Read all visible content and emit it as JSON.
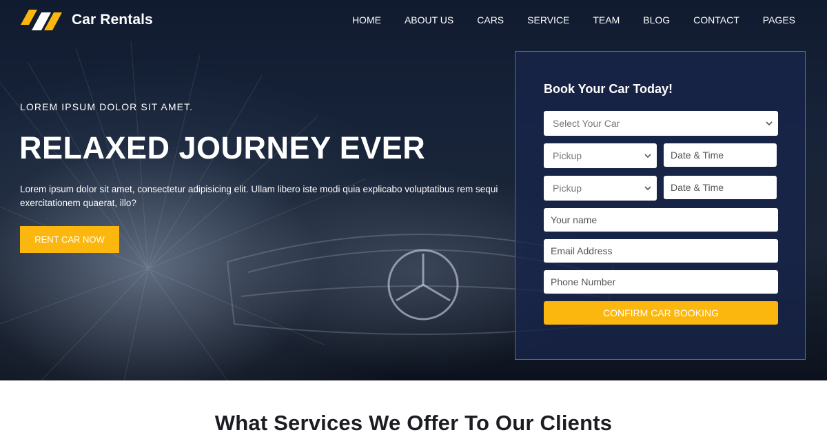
{
  "brand": {
    "name": "Car Rentals",
    "logo_icon": "brand-logo-icon",
    "accent": "#fcb70e"
  },
  "nav": [
    {
      "label": "HOME"
    },
    {
      "label": "ABOUT US"
    },
    {
      "label": "CARS"
    },
    {
      "label": "SERVICE"
    },
    {
      "label": "TEAM"
    },
    {
      "label": "BLOG"
    },
    {
      "label": "CONTACT"
    },
    {
      "label": "PAGES"
    }
  ],
  "hero": {
    "eyebrow": "LOREM IPSUM DOLOR SIT AMET.",
    "title": "RELAXED JOURNEY EVER",
    "lede": "Lorem ipsum dolor sit amet, consectetur adipisicing elit. Ullam libero iste modi quia explicabo voluptatibus rem sequi exercitationem quaerat, illo?",
    "cta": "RENT CAR NOW"
  },
  "booking": {
    "title": "Book Your Car Today!",
    "car_select": "Select Your Car",
    "pickup_1": "Pickup",
    "datetime_1": "Date & Time",
    "pickup_2": "Pickup",
    "datetime_2": "Date & Time",
    "name_placeholder": "Your name",
    "email_placeholder": "Email Address",
    "phone_placeholder": "Phone Number",
    "submit": "CONFIRM CAR BOOKING"
  },
  "services": {
    "title": "What Services We Offer To Our Clients"
  },
  "colors": {
    "accent": "#fcb70e",
    "panel": "#18244a",
    "heading": "#1b1d23"
  }
}
